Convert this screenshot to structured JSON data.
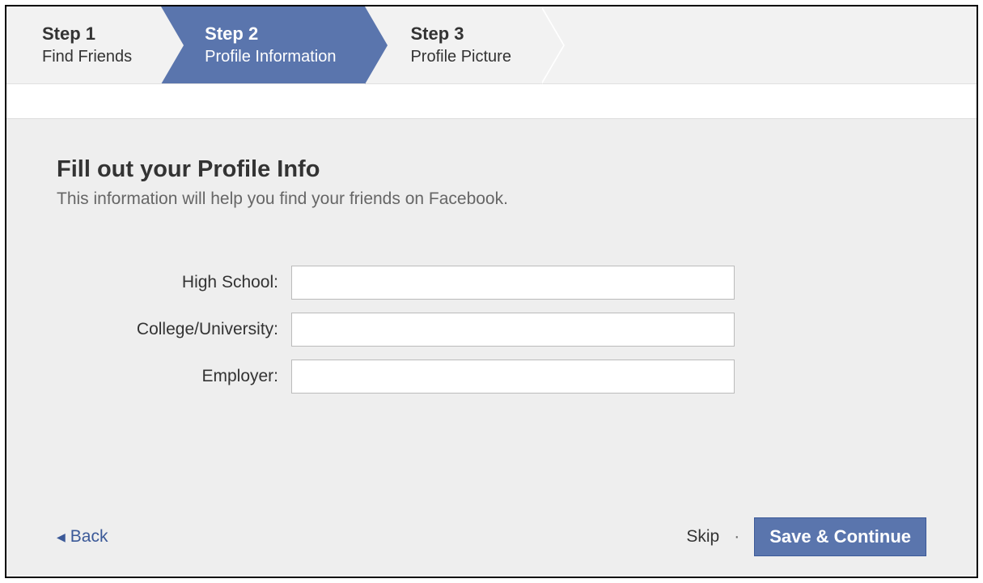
{
  "stepper": {
    "steps": [
      {
        "title": "Step 1",
        "subtitle": "Find Friends"
      },
      {
        "title": "Step 2",
        "subtitle": "Profile Information"
      },
      {
        "title": "Step 3",
        "subtitle": "Profile Picture"
      }
    ]
  },
  "page": {
    "title": "Fill out your Profile Info",
    "subtitle": "This information will help you find your friends on Facebook."
  },
  "form": {
    "high_school": {
      "label": "High School:",
      "value": ""
    },
    "college": {
      "label": "College/University:",
      "value": ""
    },
    "employer": {
      "label": "Employer:",
      "value": ""
    }
  },
  "footer": {
    "back_label": "Back",
    "skip_label": "Skip",
    "save_label": "Save & Continue"
  }
}
